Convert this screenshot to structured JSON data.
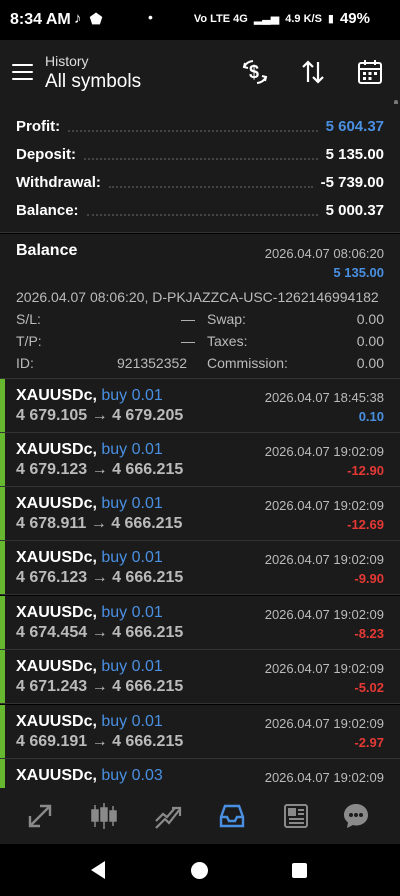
{
  "status": {
    "time": "8:34 AM",
    "network": "Vo LTE 4G",
    "speed": "4.9 K/S",
    "battery": "49%"
  },
  "header": {
    "subtitle": "History",
    "title": "All symbols"
  },
  "summary": {
    "profit_label": "Profit:",
    "profit_value": "5 604.37",
    "deposit_label": "Deposit:",
    "deposit_value": "5 135.00",
    "withdrawal_label": "Withdrawal:",
    "withdrawal_value": "-5 739.00",
    "balance_label": "Balance:",
    "balance_value": "5 000.37"
  },
  "balance_entry": {
    "title": "Balance",
    "time": "2026.04.07 08:06:20",
    "amount": "5 135.00",
    "comment": "2026.04.07 08:06:20, D-PKJAZZCA-USC-1262146994182",
    "sl_label": "S/L:",
    "sl_value": "—",
    "swap_label": "Swap:",
    "swap_value": "0.00",
    "tp_label": "T/P:",
    "tp_value": "—",
    "taxes_label": "Taxes:",
    "taxes_value": "0.00",
    "id_label": "ID:",
    "id_value": "921352352",
    "commission_label": "Commission:",
    "commission_value": "0.00"
  },
  "trades": [
    {
      "symbol": "XAUUSDc,",
      "side": "buy 0.01",
      "prices": "4 679.105 → 4 679.205",
      "time": "2026.04.07 18:45:38",
      "profit": "0.10",
      "color": "#4a90e2"
    },
    {
      "symbol": "XAUUSDc,",
      "side": "buy 0.01",
      "prices": "4 679.123 → 4 666.215",
      "time": "2026.04.07 19:02:09",
      "profit": "-12.90",
      "color": "#e53935"
    },
    {
      "symbol": "XAUUSDc,",
      "side": "buy 0.01",
      "prices": "4 678.911 → 4 666.215",
      "time": "2026.04.07 19:02:09",
      "profit": "-12.69",
      "color": "#e53935"
    },
    {
      "symbol": "XAUUSDc,",
      "side": "buy 0.01",
      "prices": "4 676.123 → 4 666.215",
      "time": "2026.04.07 19:02:09",
      "profit": "-9.90",
      "color": "#e53935"
    },
    {
      "symbol": "XAUUSDc,",
      "side": "buy 0.01",
      "prices": "4 674.454 → 4 666.215",
      "time": "2026.04.07 19:02:09",
      "profit": "-8.23",
      "color": "#e53935"
    },
    {
      "symbol": "XAUUSDc,",
      "side": "buy 0.01",
      "prices": "4 671.243 → 4 666.215",
      "time": "2026.04.07 19:02:09",
      "profit": "-5.02",
      "color": "#e53935"
    },
    {
      "symbol": "XAUUSDc,",
      "side": "buy 0.01",
      "prices": "4 669.191 → 4 666.215",
      "time": "2026.04.07 19:02:09",
      "profit": "-2.97",
      "color": "#e53935"
    },
    {
      "symbol": "XAUUSDc,",
      "side": "buy 0.03",
      "prices": "",
      "time": "2026.04.07 19:02:09",
      "profit": "",
      "color": "#e53935"
    }
  ],
  "tabs": [
    {
      "name": "quotes-icon",
      "active": false
    },
    {
      "name": "chart-icon",
      "active": false
    },
    {
      "name": "trade-icon",
      "active": false
    },
    {
      "name": "history-icon",
      "active": true
    },
    {
      "name": "news-icon",
      "active": false
    },
    {
      "name": "chat-icon",
      "active": false
    }
  ],
  "colors": {
    "accent": "#4a90e2",
    "loss": "#e53935",
    "buy_bar": "#66b82f",
    "card": "#1b1b1b"
  }
}
